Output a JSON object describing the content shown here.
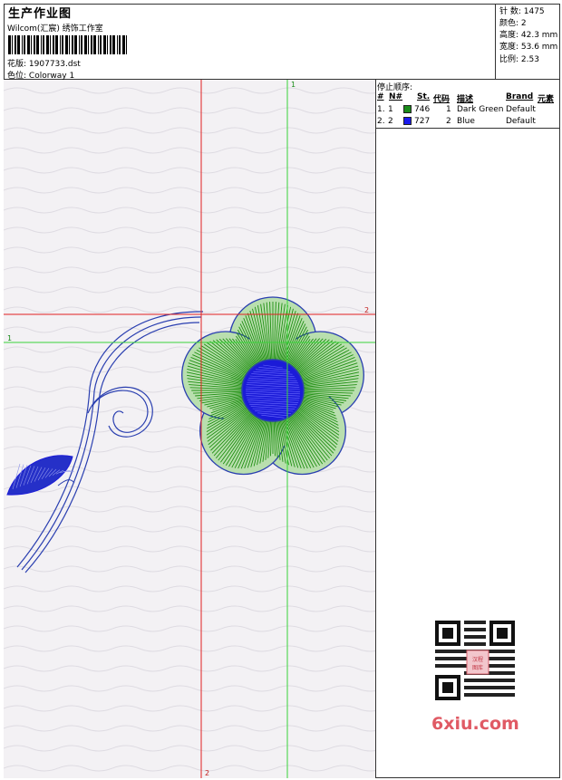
{
  "header": {
    "title": "生产作业图",
    "company": "Wilcom(汇宸) 绣饰工作室",
    "file_label": "花版:",
    "file_value": "1907733.dst",
    "colorway_label": "色位:",
    "colorway_value": "Colorway 1"
  },
  "stats": {
    "stitches": "针 数: 1475",
    "colors": "颜色: 2",
    "height": "高度: 42.3 mm",
    "width": "宽度: 53.6 mm",
    "scale": "比例: 2.53"
  },
  "stop_sequence": {
    "title": "停止顺序:",
    "columns": [
      "#",
      "N#",
      "St.",
      "代码",
      "描述",
      "Brand",
      "元素"
    ],
    "rows": [
      {
        "index": "1.",
        "needle": "1",
        "swatch_color": "#1a8c1a",
        "stitches": "746",
        "code": "1",
        "description": "Dark Green",
        "brand": "Default"
      },
      {
        "index": "2.",
        "needle": "2",
        "swatch_color": "#1a1aee",
        "stitches": "727",
        "code": "2",
        "description": "Blue",
        "brand": "Default"
      }
    ]
  },
  "axis_labels": {
    "green_v": "1",
    "green_h": "1",
    "red_h": "2",
    "red_v": "2"
  },
  "watermark": {
    "brand": "6xiu.com",
    "seal_text": "汉程图库"
  },
  "colors": {
    "green": "#1f8f12",
    "blue": "#1b1bd8",
    "red": "#e02020",
    "outline": "#2a3fb0"
  }
}
